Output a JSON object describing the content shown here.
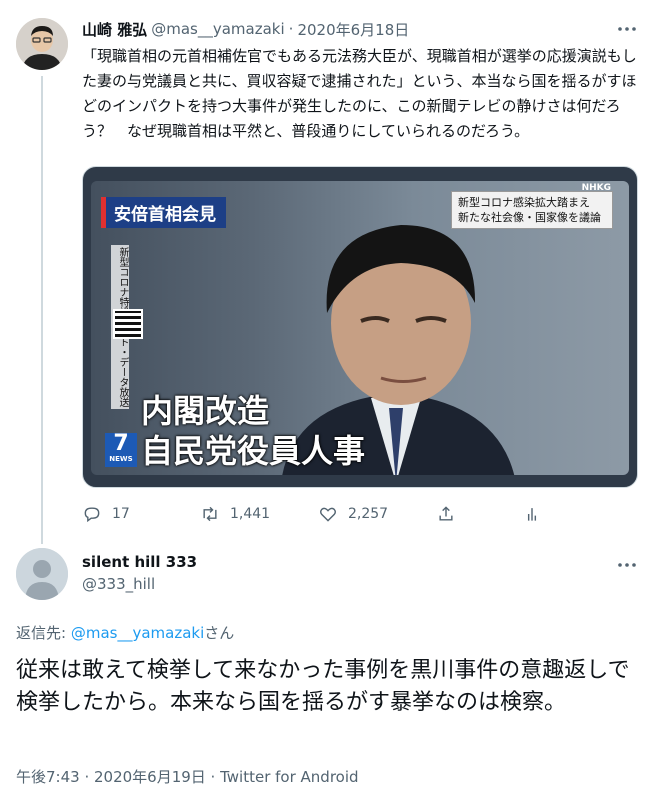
{
  "parent_tweet": {
    "author_name": "山崎 雅弘",
    "handle": "@mas__yamazaki",
    "separator": "·",
    "date": "2020年6月18日",
    "text": "「現職首相の元首相補佐官でもある元法務大臣が、現職首相が選挙の応援演説もした妻の与党議員と共に、買収容疑で逮捕された」という、本当なら国を揺るがすほどのインパクトを持つ大事件が発生したのに、この新聞テレビの静けさは何だろう？　なぜ現職首相は平然と、普段通りにしていられるのだろう。",
    "media": {
      "caption": "安倍首相会見",
      "box_text": "新型コロナ感染拡大踏まえ\n新たな社会像・国家像を議論",
      "broadcaster": "NHKG",
      "side_text": "新型コロナ特設サイト・データ放送",
      "headline": "内閣改造\n自民党役員人事",
      "channel_number": "7",
      "channel_label": "NEWS"
    },
    "actions": {
      "replies": "17",
      "retweets": "1,441",
      "likes": "2,257"
    }
  },
  "reply_tweet": {
    "author_name": "silent hill 333",
    "handle": "@333_hill",
    "replying_prefix": "返信先: ",
    "replying_to": "@mas__yamazaki",
    "replying_suffix": "さん",
    "text": "従来は敢えて検挙して来なかった事例を黒川事件の意趣返しで検挙したから。本来なら国を揺るがす暴挙なのは検察。",
    "meta": "午後7:43 · 2020年6月19日 · Twitter for Android"
  },
  "icons": {
    "reply": "reply-icon",
    "retweet": "retweet-icon",
    "like": "heart-icon",
    "share": "share-icon",
    "analytics": "analytics-icon",
    "more": "more-icon"
  },
  "colors": {
    "accent": "#1d9bf0",
    "secondary_text": "#536471",
    "thread_line": "#cfd9de"
  }
}
